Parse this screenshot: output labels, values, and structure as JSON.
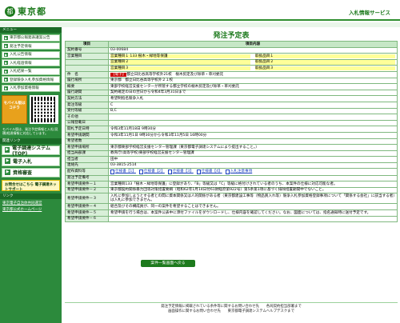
{
  "header": {
    "logo_mark": "都",
    "logo_text": "東京都",
    "service_title": "入札情報サービス"
  },
  "sidebar": {
    "menu_heading": "メニュー",
    "items": [
      {
        "label": "東京都公報発表議案公告",
        "icon": "arrow"
      },
      {
        "label": "発注予定情報",
        "icon": "arrow"
      },
      {
        "label": "入札公告情報",
        "icon": "arrow"
      },
      {
        "label": "入札経過情報",
        "icon": "arrow"
      },
      {
        "label": "入札結果一覧",
        "icon": "arrow"
      },
      {
        "label": "登録競争入札参加資格情報",
        "icon": "arrow"
      },
      {
        "label": "入札参加資格情報",
        "icon": "arrow"
      }
    ],
    "mobile_label": "モバイル版はコチラ",
    "mobile_note": "モバイル版は、発注予定情報と入札(見積)経過情報に対応しています。",
    "links_heading": "関連リンク",
    "big_items": [
      {
        "label": "電子調達システム(TOP)"
      },
      {
        "label": "電子入札"
      },
      {
        "label": "資格審査"
      }
    ],
    "qa_label": "お問合せはこちら 電子調達ネットサポート",
    "foot_heading": "リンク",
    "foot_links": [
      "東京電子自治体共同運営",
      "東京都公式ホームページ"
    ]
  },
  "main": {
    "page_title": "発注予定表",
    "col_item": "項目",
    "col_content": "項目内容",
    "rows": [
      {
        "label": "契約番号",
        "value": "03-00684"
      },
      {
        "label": "営業種目",
        "value": "営業種目１ 133 樹木・緑地等保護",
        "extra": "取扱品目１"
      },
      {
        "label": "",
        "value": "営業種目２",
        "extra": "取扱品目２"
      },
      {
        "label": "",
        "value": "営業種目３",
        "extra": "取扱品目３"
      },
      {
        "label": "件　名",
        "tag": "【電子】",
        "value": "都立日比谷高等学校外21校　樹木剪定及び除草・草刈委託"
      },
      {
        "label": "履行場所",
        "value": "東京都　都立日比谷高等学校外２１校"
      },
      {
        "label": "概要",
        "value": "東部学校経営支援センターが所管する都立学校の樹木剪定及び除草・草刈委託"
      },
      {
        "label": "履行期間",
        "value": "契約確定の日の翌日から令和4年3月31日まで"
      },
      {
        "label": "契約方法",
        "value": "希望制指名競争入札"
      },
      {
        "label": "発注等級",
        "value": "C"
      },
      {
        "label": "受付等級",
        "value": "B,C"
      },
      {
        "label": "その他",
        "value": ""
      },
      {
        "label": "公報登載日",
        "value": ""
      },
      {
        "label": "開札予定日時",
        "value": "令和3年11月18日 9時30分"
      },
      {
        "label": "希望申請期間",
        "value": "令和3年11月1日 9時30分から令和3年11月5日 16時00分"
      },
      {
        "label": "希望者数",
        "value": ""
      },
      {
        "label": "希望申請場所",
        "value": "東京都東部学校経営支援センター管理課（東京都電子調達システムにより提出すること。）"
      },
      {
        "label": "担当局部課",
        "value": "教育庁(高等学校)東部学校経営支援センター管理課"
      },
      {
        "label": "担当者",
        "value": "田中"
      },
      {
        "label": "連絡先",
        "value": "03-3815-2514"
      }
    ],
    "files_label": "配布資料等",
    "files": [
      "仕様書【1】",
      "仕様書【2】",
      "仕様書【3】",
      "仕様書【4】",
      "入札注意事項"
    ],
    "conditions": [
      {
        "label": "発注予定備考",
        "value": ""
      },
      {
        "label": "希望申請要件－１",
        "value": "営業種目133「樹木・緑地等保護」に登録があり、「B」等級又は「C」等級に格付けされている者のうち、本案件の仕様に対応可能な者。"
      },
      {
        "label": "希望申請要件－２",
        "value": "東京都契約関係暴力団等対策措置要綱（昭和62年1月14日付61財経庶第922号）第5条第1項に基づく排除措置期間中でないこと。"
      },
      {
        "label": "希望申請要件－３",
        "value": "入札に参加しようとする者との間に資本関係又は人的関係がある者（東京都建設工事等（物品買入れ等）競争入札参加資格登録事項について「関係する会社」に該当する者）は入札に参加できません。"
      },
      {
        "label": "希望申請要件－４",
        "value": "組合及びその構成員が、同一の案件を希望することはできません。"
      },
      {
        "label": "希望申請要件－５",
        "value": "希望申請を行う場合は、本案件公表中に添付ファイルをダウンロードし、仕様内容を確認してください。なお、図面については、指名通知時に送付予定です。"
      },
      {
        "label": "希望申請要件－６",
        "value": ""
      }
    ],
    "back_button": "案件一覧画面へ戻る"
  },
  "footer": {
    "line1": "発注予定情報に掲載されている条件等に関するお問い合わせ先　　各局契約担当部署まで",
    "line2": "画面操作に関するお問い合わせ先　　東京都電子調達システムヘルプデスクまで"
  }
}
